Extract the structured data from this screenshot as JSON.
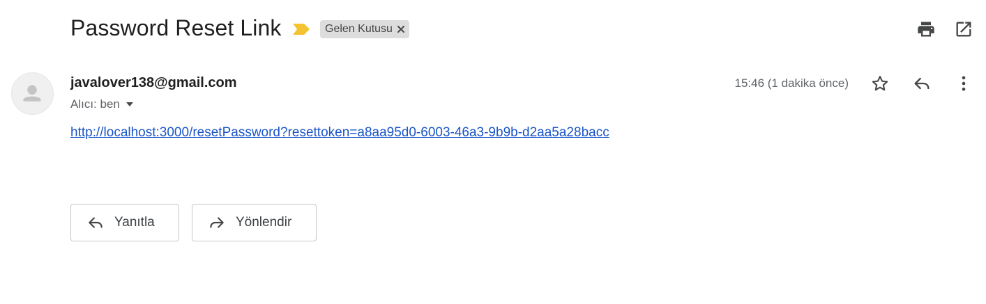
{
  "email": {
    "subject": "Password Reset Link",
    "importance_marker": "importance-marker-icon",
    "label": "Gelen Kutusu",
    "sender": "javalover138@gmail.com",
    "recipient": "Alıcı: ben",
    "timestamp": "15:46 (1 dakika önce)",
    "body_link": "http://localhost:3000/resetPassword?resettoken=a8aa95d0-6003-46a3-9b9b-d2aa5a28bacc"
  },
  "actions": {
    "reply_label": "Yanıtla",
    "forward_label": "Yönlendir"
  },
  "icons": {
    "print": "print-icon",
    "open_new_window": "open-in-new-window-icon",
    "star": "star-icon",
    "reply": "reply-icon",
    "more": "more-vertical-icon",
    "forward": "forward-icon",
    "avatar": "person-icon"
  },
  "colors": {
    "importance": "#f4c430",
    "link": "#1a55c8",
    "chip_bg": "#dddddd",
    "icon": "#444746"
  }
}
